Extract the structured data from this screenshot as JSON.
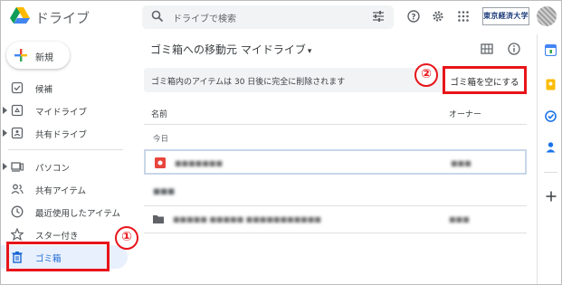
{
  "header": {
    "app_name": "ドライブ",
    "search_placeholder": "ドライブで検索",
    "org_badge": "東京経済大学"
  },
  "sidebar": {
    "new_label": "新規",
    "items": [
      {
        "label": "候補",
        "icon": "check-circle-icon"
      },
      {
        "label": "マイドライブ",
        "icon": "my-drive-icon"
      },
      {
        "label": "共有ドライブ",
        "icon": "shared-drive-icon"
      },
      {
        "label": "パソコン",
        "icon": "computer-icon"
      },
      {
        "label": "共有アイテム",
        "icon": "people-icon"
      },
      {
        "label": "最近使用したアイテム",
        "icon": "clock-icon"
      },
      {
        "label": "スター付き",
        "icon": "star-icon"
      },
      {
        "label": "ゴミ箱",
        "icon": "trash-icon"
      }
    ]
  },
  "main": {
    "title": "ゴミ箱への移動元",
    "location": "マイドライブ",
    "banner_text": "ゴミ箱内のアイテムは 30 日後に完全に削除されます",
    "empty_trash_label": "ゴミ箱を空にする",
    "columns": {
      "name": "名前",
      "owner": "オーナー"
    },
    "sections": [
      {
        "label": "今日",
        "files": [
          {
            "name": "■■■■■■■",
            "owner": "■■■",
            "icon": "image-file-icon"
          }
        ]
      },
      {
        "label": "■■■",
        "files": [
          {
            "name": "■■■■■ ■■■■■ ■■■■■■■■■■■",
            "owner": "■■■",
            "icon": "folder-icon"
          }
        ]
      }
    ]
  },
  "annotations": {
    "badge_1": "①",
    "badge_2": "②"
  },
  "colors": {
    "accent": "#1967d2",
    "highlight": "#e8141a",
    "selected_bg": "#e8f0fe"
  }
}
